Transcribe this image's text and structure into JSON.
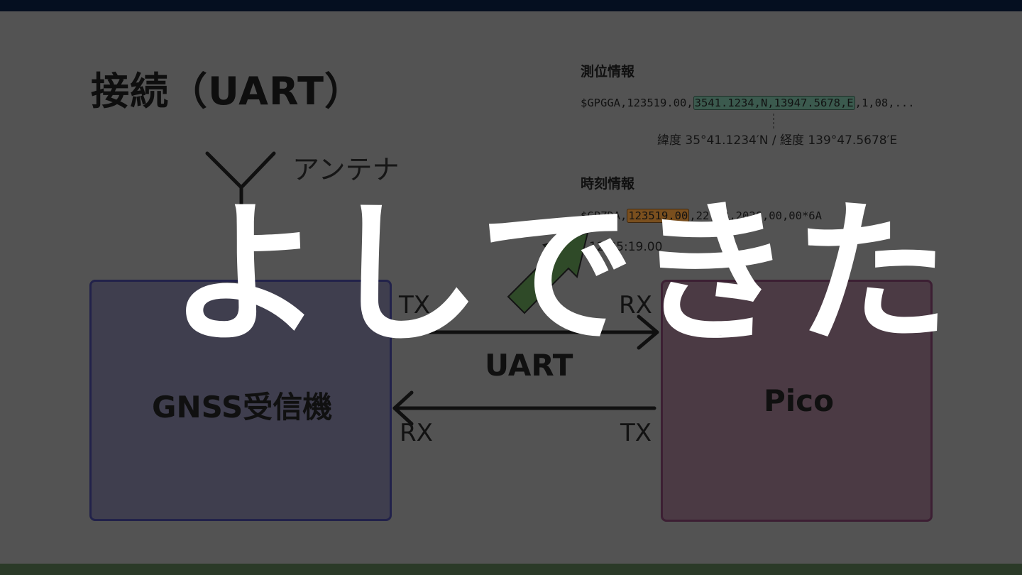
{
  "slide": {
    "title": "接続（UART）",
    "antenna_label": "アンテナ",
    "gnss_label": "GNSS受信機",
    "pico_label": "Pico",
    "uart_label": "UART",
    "gnss_tx": "TX",
    "gnss_rx": "RX",
    "pico_rx": "RX",
    "pico_tx": "TX"
  },
  "position_info": {
    "heading": "測位情報",
    "sentence_prefix": "$GPGGA,123519.00,",
    "sentence_highlight": "3541.1234,N,13947.5678,E",
    "sentence_suffix": ",1,08,...",
    "decoded": "緯度 35°41.1234′N / 経度 139°47.5678′E"
  },
  "time_info": {
    "heading": "時刻情報",
    "sentence_prefix": "$GPZDA,",
    "sentence_highlight": "123519.00",
    "sentence_suffix": ",22,08,2026,00,00*6A",
    "decoded": "12:35:19.00"
  },
  "overlay": {
    "text": "よしできた"
  },
  "colors": {
    "background": "#535353",
    "gnss_box": "#3f3e4e",
    "pico_box": "#4b3a44",
    "highlight_green": "#3b5a4e",
    "highlight_orange": "#7a4f1e",
    "arrow_green": "#2f4a28",
    "overlay_text": "#ffffff"
  }
}
